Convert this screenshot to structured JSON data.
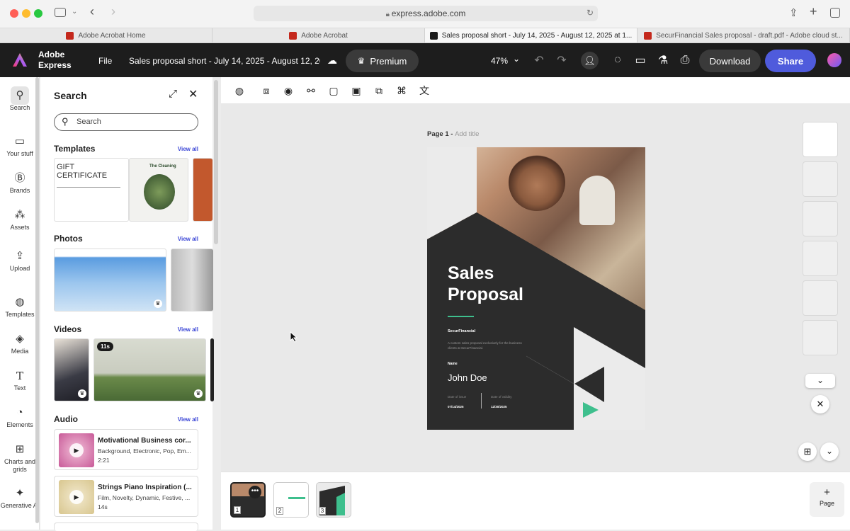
{
  "browser": {
    "url": "express.adobe.com",
    "tabs": [
      {
        "label": "Adobe Acrobat Home"
      },
      {
        "label": "Adobe Acrobat"
      },
      {
        "label": "Sales proposal short - July 14, 2025 - August 12, 2025 at 1..."
      },
      {
        "label": "SecurFinancial Sales proposal - draft.pdf - Adobe cloud st..."
      }
    ]
  },
  "header": {
    "app_name_line1": "Adobe",
    "app_name_line2": "Express",
    "file_label": "File",
    "doc_title": "Sales proposal short - July 14, 2025 - August 12, 2025 at ...",
    "premium_label": "Premium",
    "zoom": "47%",
    "download_label": "Download",
    "share_label": "Share"
  },
  "rail": {
    "items": [
      {
        "label": "Search",
        "icon": "search-icon"
      },
      {
        "label": "Your stuff",
        "icon": "folder-icon"
      },
      {
        "label": "Brands",
        "icon": "brand-icon"
      },
      {
        "label": "Assets",
        "icon": "assets-icon"
      },
      {
        "label": "Upload",
        "icon": "upload-icon"
      },
      {
        "label": "Templates",
        "icon": "templates-icon"
      },
      {
        "label": "Media",
        "icon": "media-icon"
      },
      {
        "label": "Text",
        "icon": "text-icon"
      },
      {
        "label": "Elements",
        "icon": "elements-icon"
      },
      {
        "label": "Charts and grids",
        "icon": "charts-icon"
      },
      {
        "label": "Generative AI",
        "icon": "generative-ai-icon"
      }
    ]
  },
  "panel": {
    "title": "Search",
    "search_placeholder": "Search",
    "view_all": "View all",
    "templates_title": "Templates",
    "gift_cert_line1": "GIFT",
    "gift_cert_line2": "CERTIFICATE",
    "cleaning_title": "The Cleaning",
    "photos_title": "Photos",
    "videos_title": "Videos",
    "video_badge": "11s",
    "audio_title": "Audio",
    "audio": [
      {
        "title": "Motivational Business cor...",
        "tags": "Background, Electronic, Pop, Em...",
        "duration": "2:21"
      },
      {
        "title": "Strings Piano Inspiration (...",
        "tags": "Film, Novelty, Dynamic, Festive, ...",
        "duration": "14s"
      }
    ]
  },
  "canvas": {
    "page_label": "Page 1 -",
    "add_title": "Add title",
    "doc": {
      "title_line1": "Sales",
      "title_line2": "Proposal",
      "company": "SecurFinancial",
      "description_line1": "A custom sales proposal exclusively for the business",
      "description_line2": "clients at SecurFinancial.",
      "name_label": "Name",
      "name_value": "John Doe",
      "issue_label": "Date of issue",
      "issue_value": "07/14/2025",
      "validity_label": "Date of validity",
      "validity_value": "12/30/2025"
    }
  },
  "pages": [
    {
      "number": "1"
    },
    {
      "number": "2"
    },
    {
      "number": "3"
    }
  ],
  "add_page_label": "Page",
  "colors": {
    "accent": "#4f5bdc",
    "doc_dark": "#2c2c2c",
    "doc_green": "#3ebf8d"
  }
}
